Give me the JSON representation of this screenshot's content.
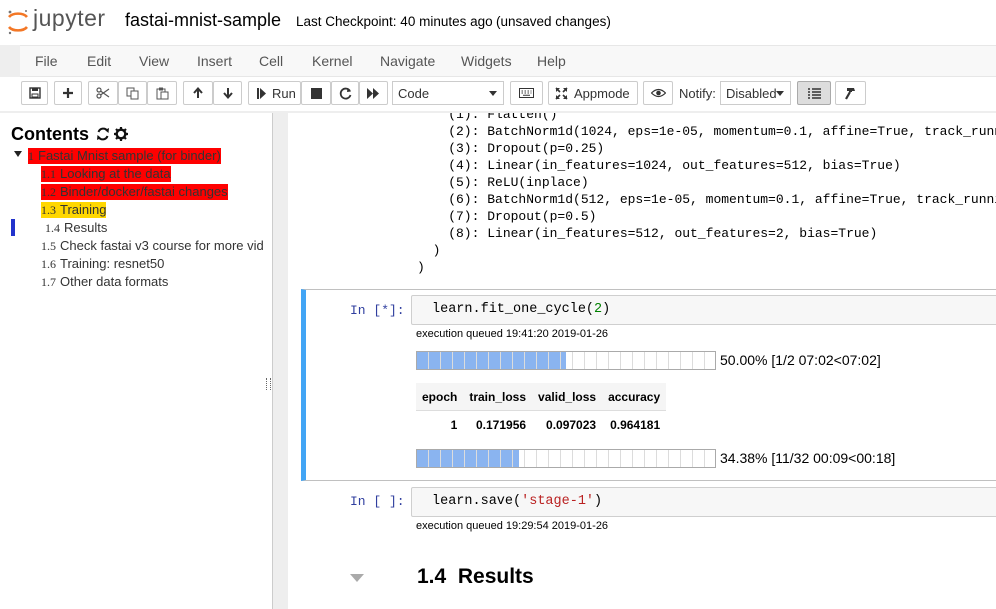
{
  "header": {
    "logo_text": "jupyter",
    "notebook_name": "fastai-mnist-sample",
    "checkpoint": "Last Checkpoint: 40 minutes ago",
    "unsaved": "(unsaved changes)"
  },
  "menu": [
    "File",
    "Edit",
    "View",
    "Insert",
    "Cell",
    "Kernel",
    "Navigate",
    "Widgets",
    "Help"
  ],
  "toolbar": {
    "run_label": "Run",
    "cell_type": "Code",
    "appmode_label": "Appmode",
    "notify_label": "Notify:",
    "notify_value": "Disabled"
  },
  "toc": {
    "title": "Contents",
    "items": [
      {
        "num": "1",
        "label": "Fastai Mnist sample (for binder)"
      },
      {
        "num": "1.1",
        "label": "Looking at the data"
      },
      {
        "num": "1.2",
        "label": "Binder/docker/fastai changes"
      },
      {
        "num": "1.3",
        "label": "Training"
      },
      {
        "num": "1.4",
        "label": "Results"
      },
      {
        "num": "1.5",
        "label": "Check fastai v3 course for more vid"
      },
      {
        "num": "1.6",
        "label": "Training: resnet50"
      },
      {
        "num": "1.7",
        "label": "Other data formats"
      }
    ]
  },
  "output_lines": [
    "    (1): Flatten()",
    "    (2): BatchNorm1d(1024, eps=1e-05, momentum=0.1, affine=True, track_runni",
    "    (3): Dropout(p=0.25)",
    "    (4): Linear(in_features=1024, out_features=512, bias=True)",
    "    (5): ReLU(inplace)",
    "    (6): BatchNorm1d(512, eps=1e-05, momentum=0.1, affine=True, track_runnin",
    "    (7): Dropout(p=0.5)",
    "    (8): Linear(in_features=512, out_features=2, bias=True)",
    "  )",
    ")"
  ],
  "cell1": {
    "prompt": "In [*]:",
    "code_prefix": "learn.fit_one_cycle(",
    "code_arg": "2",
    "code_suffix": ")",
    "exec_time": "execution queued 19:41:20 2019-01-26",
    "progress1": {
      "fraction": 0.5,
      "text": "50.00% [1/2 07:02<07:02]"
    },
    "table": {
      "headers": [
        "epoch",
        "train_loss",
        "valid_loss",
        "accuracy"
      ],
      "rows": [
        [
          "1",
          "0.171956",
          "0.097023",
          "0.964181"
        ]
      ]
    },
    "progress2": {
      "fraction": 0.3438,
      "text": "34.38% [11/32 00:09<00:18]"
    }
  },
  "cell2": {
    "prompt": "In [ ]:",
    "code_prefix": "learn.save(",
    "code_arg": "'stage-1'",
    "code_suffix": ")",
    "exec_time": "execution queued 19:29:54 2019-01-26"
  },
  "results_heading": {
    "num": "1.4",
    "title": "Results"
  }
}
